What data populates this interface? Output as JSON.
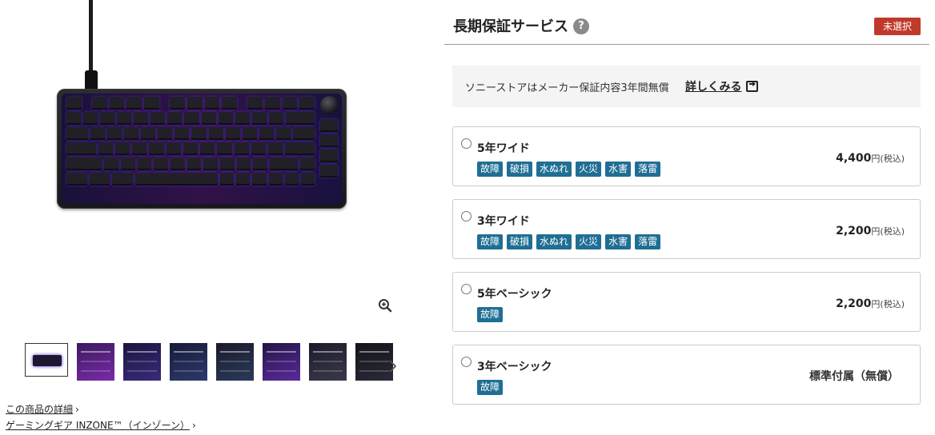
{
  "thumbnails": {
    "items": [
      {
        "name": "keyboard",
        "colors": [
          "#ffffff",
          "#2a1e6a"
        ]
      },
      {
        "name": "keyboard-purple",
        "colors": [
          "#3a1a5e",
          "#7a2aa8"
        ]
      },
      {
        "name": "feature-1",
        "colors": [
          "#1a1640",
          "#3a2a7a"
        ]
      },
      {
        "name": "feature-2",
        "colors": [
          "#181a3a",
          "#2b3a6a"
        ]
      },
      {
        "name": "feature-3",
        "colors": [
          "#1a1a2a",
          "#2a3a5a"
        ]
      },
      {
        "name": "feature-4",
        "colors": [
          "#221446",
          "#5a2a9a"
        ]
      },
      {
        "name": "feature-5",
        "colors": [
          "#1a1a2a",
          "#3a3a4a"
        ]
      },
      {
        "name": "feature-6",
        "colors": [
          "#141418",
          "#2a2a3a"
        ]
      }
    ]
  },
  "links": {
    "product_detail": "この商品の詳細",
    "category": "ゲーミングギア INZONE™（インゾーン）"
  },
  "warranty": {
    "title": "長期保証サービス",
    "help_symbol": "?",
    "status": "未選択",
    "info_text": "ソニーストアはメーカー保証内容3年間無償",
    "info_link": "詳しくみる",
    "options": [
      {
        "name": "5年ワイド",
        "tags": [
          "故障",
          "破損",
          "水ぬれ",
          "火災",
          "水害",
          "落雷"
        ],
        "price": "4,400",
        "price_unit": "円(税込)"
      },
      {
        "name": "3年ワイド",
        "tags": [
          "故障",
          "破損",
          "水ぬれ",
          "火災",
          "水害",
          "落雷"
        ],
        "price": "2,200",
        "price_unit": "円(税込)"
      },
      {
        "name": "5年ベーシック",
        "tags": [
          "故障"
        ],
        "price": "2,200",
        "price_unit": "円(税込)"
      },
      {
        "name": "3年ベーシック",
        "tags": [
          "故障"
        ],
        "standard": "標準付属（無償）"
      }
    ]
  },
  "colors": {
    "badge_red": "#c0392b",
    "tag_blue": "#1f6e94",
    "info_bg": "#f4f4f4"
  }
}
